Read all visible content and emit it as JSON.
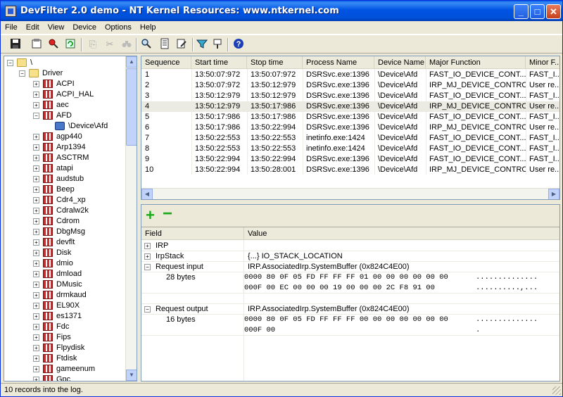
{
  "window": {
    "title": "DevFilter 2.0 demo - NT Kernel Resources: www.ntkernel.com",
    "min": "_",
    "max": "□",
    "close": "✕"
  },
  "menu": [
    "File",
    "Edit",
    "View",
    "Device",
    "Options",
    "Help"
  ],
  "toolbar_icons": [
    "save-icon",
    "properties-icon",
    "filter-icon",
    "refresh-icon",
    "copy-icon",
    "cut-icon",
    "binoculars-icon",
    "search-icon",
    "device-props-icon",
    "edit-props-icon",
    "funnel-icon",
    "clear-filter-icon",
    "help-icon"
  ],
  "tree": {
    "root": "\\",
    "driver_folder": "Driver",
    "items": [
      {
        "label": "ACPI",
        "expanded": false
      },
      {
        "label": "ACPI_HAL",
        "expanded": false
      },
      {
        "label": "aec",
        "expanded": false
      },
      {
        "label": "AFD",
        "expanded": true
      },
      {
        "label": "\\Device\\Afd",
        "child": true
      },
      {
        "label": "agp440",
        "expanded": false
      },
      {
        "label": "Arp1394",
        "expanded": false
      },
      {
        "label": "ASCTRM",
        "expanded": false
      },
      {
        "label": "atapi",
        "expanded": false
      },
      {
        "label": "audstub",
        "expanded": false
      },
      {
        "label": "Beep",
        "expanded": false
      },
      {
        "label": "Cdr4_xp",
        "expanded": false
      },
      {
        "label": "Cdralw2k",
        "expanded": false
      },
      {
        "label": "Cdrom",
        "expanded": false
      },
      {
        "label": "DbgMsg",
        "expanded": false
      },
      {
        "label": "devflt",
        "expanded": false
      },
      {
        "label": "Disk",
        "expanded": false
      },
      {
        "label": "dmio",
        "expanded": false
      },
      {
        "label": "dmload",
        "expanded": false
      },
      {
        "label": "DMusic",
        "expanded": false
      },
      {
        "label": "drmkaud",
        "expanded": false
      },
      {
        "label": "EL90X",
        "expanded": false
      },
      {
        "label": "es1371",
        "expanded": false
      },
      {
        "label": "Fdc",
        "expanded": false
      },
      {
        "label": "Fips",
        "expanded": false
      },
      {
        "label": "Flpydisk",
        "expanded": false
      },
      {
        "label": "Ftdisk",
        "expanded": false
      },
      {
        "label": "gameenum",
        "expanded": false
      },
      {
        "label": "Gpc",
        "expanded": false
      }
    ]
  },
  "log": {
    "columns": [
      "Sequence",
      "Start time",
      "Stop time",
      "Process Name",
      "Device Name",
      "Major Function",
      "Minor F..."
    ],
    "rows": [
      [
        "1",
        "13:50:07:972",
        "13:50:07:972",
        "DSRSvc.exe:1396",
        "\\Device\\Afd",
        "FAST_IO_DEVICE_CONT...",
        "FAST_I..."
      ],
      [
        "2",
        "13:50:07:972",
        "13:50:12:979",
        "DSRSvc.exe:1396",
        "\\Device\\Afd",
        "IRP_MJ_DEVICE_CONTROL",
        "User re..."
      ],
      [
        "3",
        "13:50:12:979",
        "13:50:12:979",
        "DSRSvc.exe:1396",
        "\\Device\\Afd",
        "FAST_IO_DEVICE_CONT...",
        "FAST_I..."
      ],
      [
        "4",
        "13:50:12:979",
        "13:50:17:986",
        "DSRSvc.exe:1396",
        "\\Device\\Afd",
        "IRP_MJ_DEVICE_CONTROL",
        "User re..."
      ],
      [
        "5",
        "13:50:17:986",
        "13:50:17:986",
        "DSRSvc.exe:1396",
        "\\Device\\Afd",
        "FAST_IO_DEVICE_CONT...",
        "FAST_I..."
      ],
      [
        "6",
        "13:50:17:986",
        "13:50:22:994",
        "DSRSvc.exe:1396",
        "\\Device\\Afd",
        "IRP_MJ_DEVICE_CONTROL",
        "User re..."
      ],
      [
        "7",
        "13:50:22:553",
        "13:50:22:553",
        "inetinfo.exe:1424",
        "\\Device\\Afd",
        "FAST_IO_DEVICE_CONT...",
        "FAST_I..."
      ],
      [
        "8",
        "13:50:22:553",
        "13:50:22:553",
        "inetinfo.exe:1424",
        "\\Device\\Afd",
        "FAST_IO_DEVICE_CONT...",
        "FAST_I..."
      ],
      [
        "9",
        "13:50:22:994",
        "13:50:22:994",
        "DSRSvc.exe:1396",
        "\\Device\\Afd",
        "FAST_IO_DEVICE_CONT...",
        "FAST_I..."
      ],
      [
        "10",
        "13:50:22:994",
        "13:50:28:001",
        "DSRSvc.exe:1396",
        "\\Device\\Afd",
        "IRP_MJ_DEVICE_CONTROL",
        "User re..."
      ]
    ],
    "selected_row": 4
  },
  "details": {
    "plus": "+",
    "minus": "−",
    "columns": [
      "Field",
      "Value"
    ],
    "rows": [
      {
        "exp": "+",
        "field": "IRP",
        "value": ""
      },
      {
        "exp": "+",
        "field": "IrpStack",
        "value": "{...} IO_STACK_LOCATION"
      },
      {
        "exp": "−",
        "field": "Request input",
        "value": "IRP.AssociatedIrp.SystemBuffer (0x824C4E00)"
      },
      {
        "field": "28 bytes",
        "sub": true,
        "hex1": "0000 80 0F 05 FD FF FF FF 01 00 00 00 00 00 00",
        "asc1": "..............",
        "hex2": "000F 00 EC 00 00 00 19 00 00 00 2C F8 91 00",
        "asc2": "..........,..."
      },
      {
        "blank": true
      },
      {
        "exp": "−",
        "field": "Request output",
        "value": "IRP.AssociatedIrp.SystemBuffer (0x824C4E00)"
      },
      {
        "field": "16 bytes",
        "sub": true,
        "hex1": "0000 80 0F 05 FD FF FF FF 00 00 00 00 00 00 00",
        "asc1": "..............",
        "hex2": "000F 00",
        "asc2": "."
      }
    ]
  },
  "status": "10 records into the log."
}
